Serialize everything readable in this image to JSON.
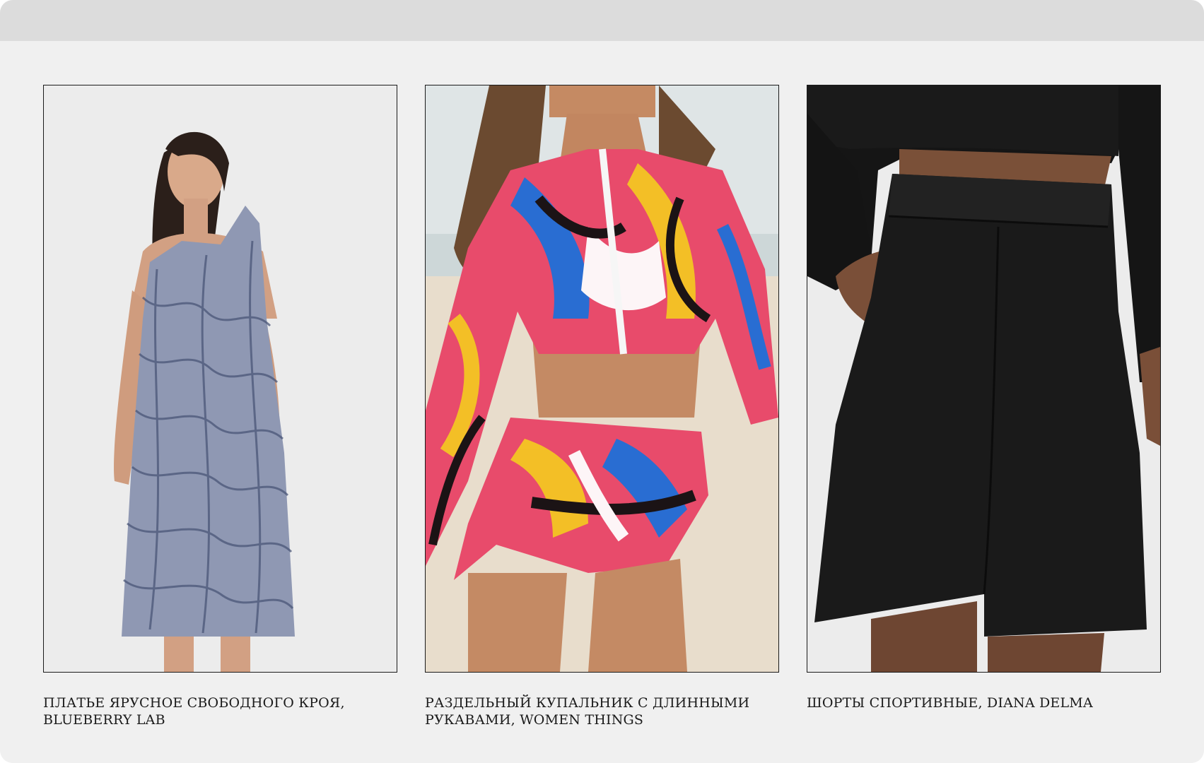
{
  "products": [
    {
      "caption": "ПЛАТЬЕ ЯРУСНОЕ СВОБОДНОГО КРОЯ, BLUEBERRY LAB"
    },
    {
      "caption": "РАЗДЕЛЬНЫЙ КУПАЛЬНИК С ДЛИННЫМИ РУКАВАМИ, WOMEN THINGS"
    },
    {
      "caption": "ШОРТЫ СПОРТИВНЫЕ, DIANA DELMA"
    }
  ],
  "colors": {
    "page_background": "#f0f0f0",
    "top_bar": "#dcdcdc",
    "card_border": "#1a1a1a",
    "caption_text": "#1b1b1b"
  }
}
